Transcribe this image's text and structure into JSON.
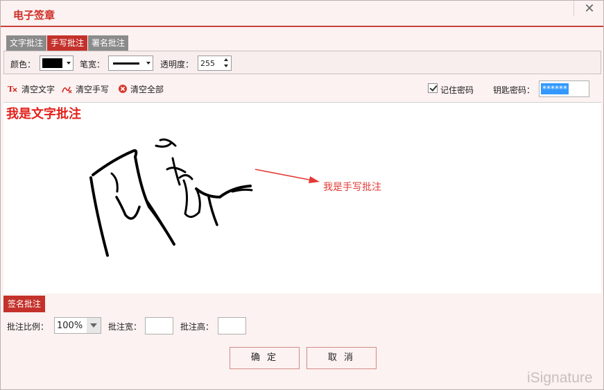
{
  "window": {
    "title": "电子签章",
    "close_glyph": "✕"
  },
  "tabs": [
    {
      "label": "文字批注",
      "active": false
    },
    {
      "label": "手写批注",
      "active": true
    },
    {
      "label": "署名批注",
      "active": false
    }
  ],
  "toolbar": {
    "color_label": "颜色：",
    "color_value": "#000000",
    "pen_width_label": "笔宽：",
    "opacity_label": "透明度：",
    "opacity_value": "255"
  },
  "actions": {
    "clear_text": "清空文字",
    "clear_handwriting": "清空手写",
    "clear_all": "清空全部",
    "remember_password_label": "记住密码",
    "remember_password_checked": true,
    "key_password_label": "钥匙密码：",
    "key_password_value": "******"
  },
  "canvas": {
    "text_annotation": "我是文字批注",
    "handwriting_label": "我是手写批注",
    "ink_color": "#000000",
    "annotation_color": "#e41f1a"
  },
  "signature": {
    "section_label": "签名批注",
    "scale_label": "批注比例：",
    "scale_value": "100%",
    "width_label": "批注宽：",
    "width_value": "",
    "height_label": "批注高：",
    "height_value": ""
  },
  "buttons": {
    "ok": "确 定",
    "cancel": "取 消"
  },
  "watermark": "iSignature",
  "colors": {
    "accent": "#c4312b",
    "tab_inactive": "#8b8b8b",
    "background": "#fbf2f1"
  }
}
